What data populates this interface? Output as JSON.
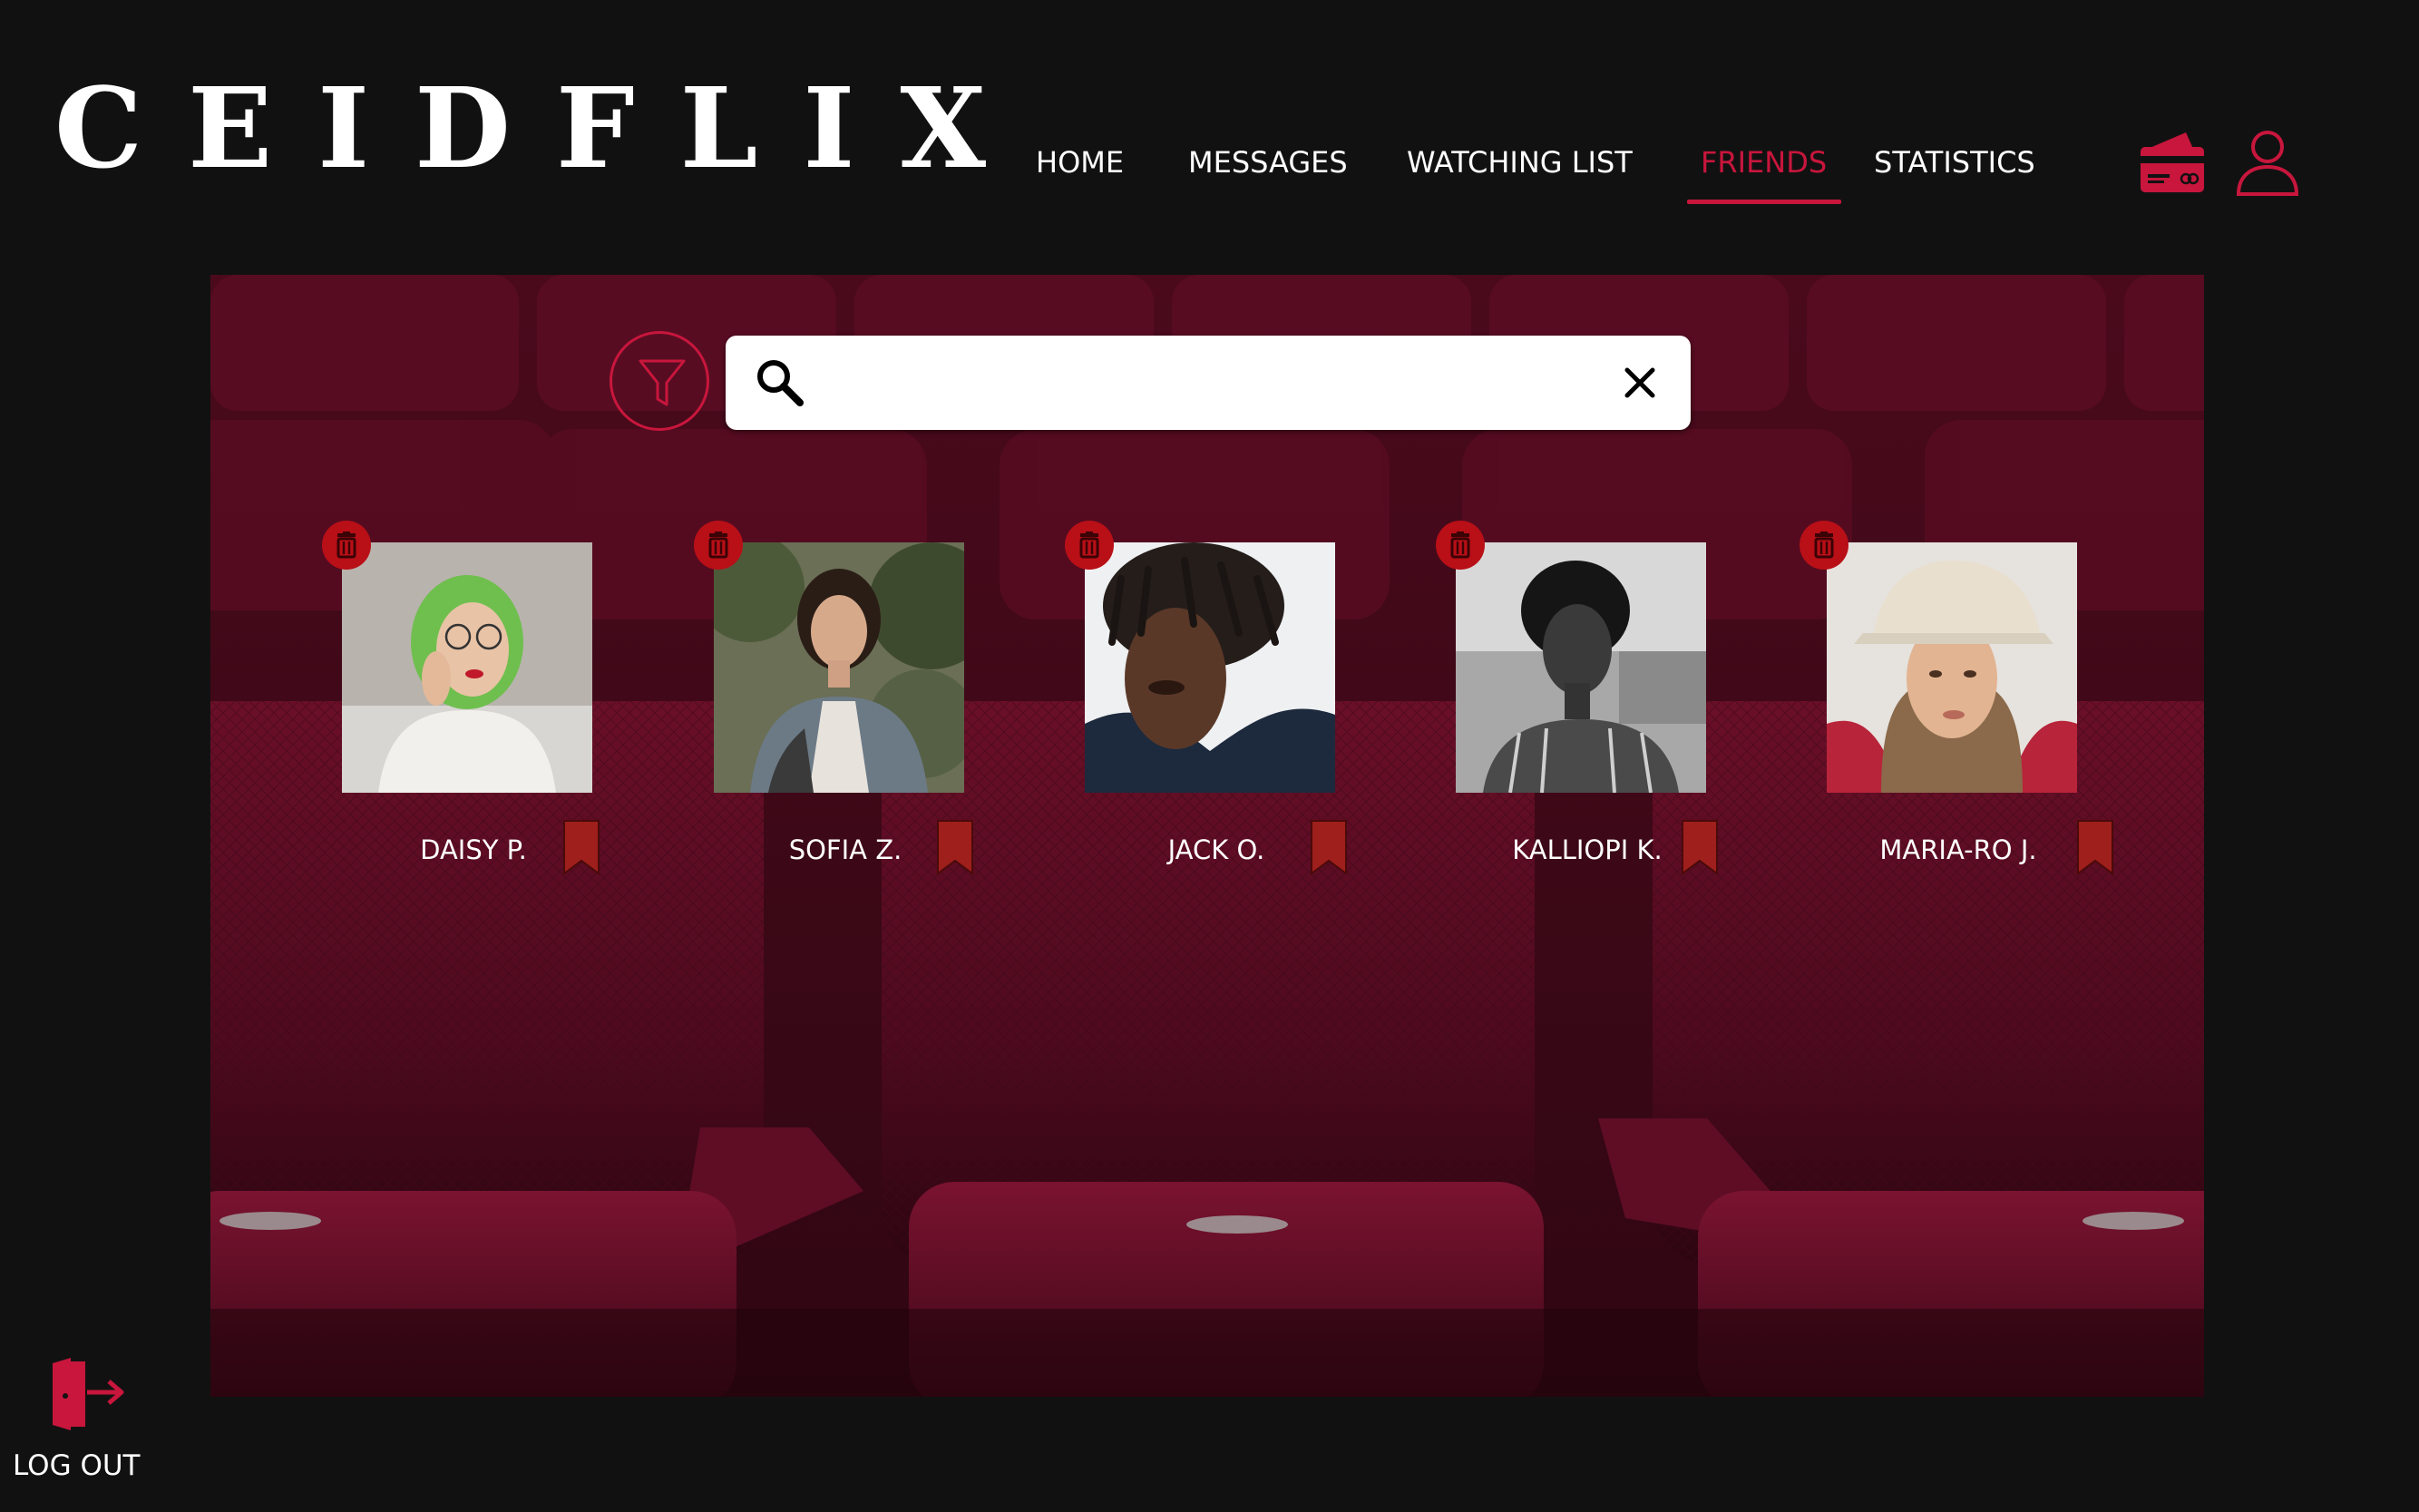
{
  "brand": {
    "logo_text": "CEIDFLIX"
  },
  "nav": {
    "items": [
      {
        "label": "HOME"
      },
      {
        "label": "MESSAGES"
      },
      {
        "label": "WATCHING LIST"
      },
      {
        "label": "FRIENDS",
        "active": true
      },
      {
        "label": "STATISTICS"
      }
    ],
    "icons": [
      "credit-card-icon",
      "user-profile-icon"
    ]
  },
  "search": {
    "value": "",
    "placeholder": "",
    "icons": [
      "filter-icon",
      "search-icon",
      "close-icon"
    ]
  },
  "friends": [
    {
      "name": "DAISY P.",
      "photo_desc": "woman with green hair and glasses"
    },
    {
      "name": "SOFIA Z.",
      "photo_desc": "woman in denim jacket"
    },
    {
      "name": "JACK O.",
      "photo_desc": "man with dreadlocks"
    },
    {
      "name": "KALLIOPI K.",
      "photo_desc": "woman black and white portrait"
    },
    {
      "name": "MARIA-RO J.",
      "photo_desc": "woman in bucket hat"
    }
  ],
  "friend_icons": [
    "trash-icon",
    "bookmark-icon"
  ],
  "logout": {
    "label": "LOG OUT",
    "icon": "logout-door-icon"
  },
  "colors": {
    "background": "#121112",
    "accent": "#c8163c",
    "delete": "#b90f17",
    "bookmark": "#9e1f1c",
    "seat": "#5a0c22",
    "text": "#ffffff"
  }
}
